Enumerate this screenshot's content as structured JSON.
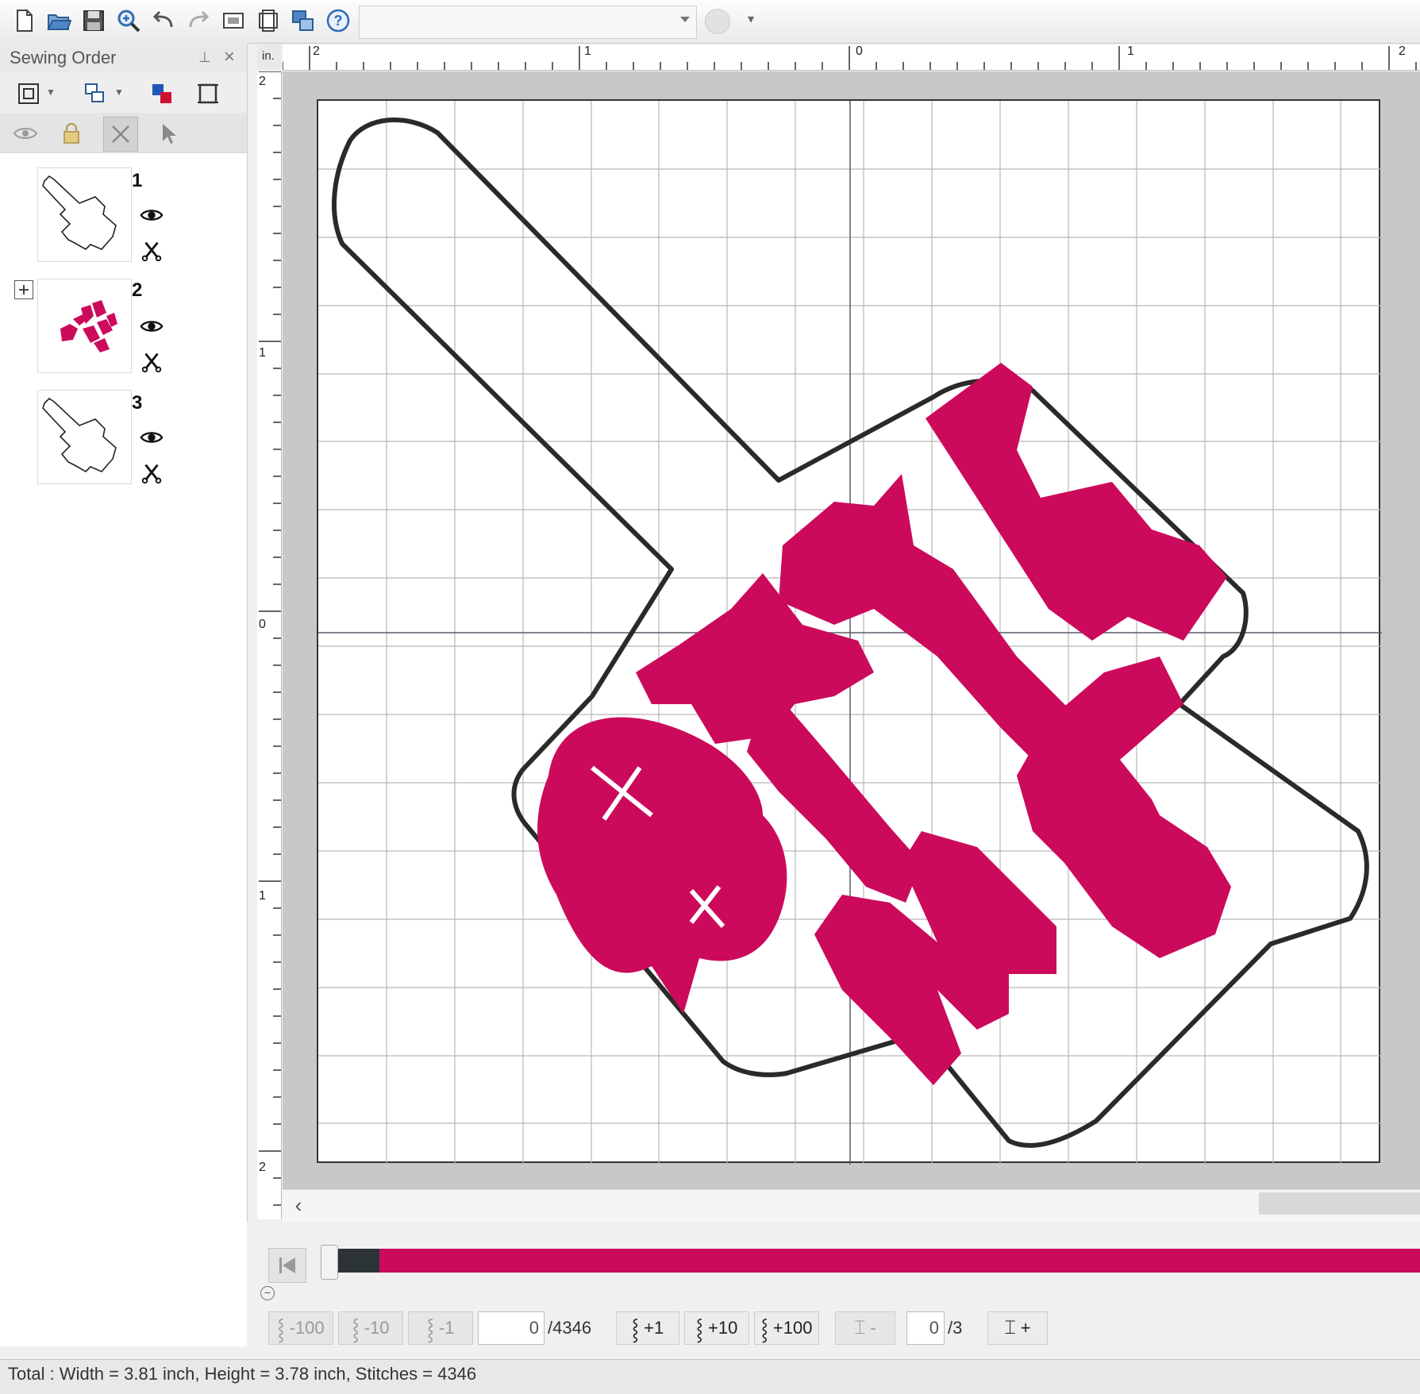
{
  "toolbar": {
    "icons": [
      "new-file-icon",
      "open-folder-icon",
      "save-icon",
      "zoom-in-icon",
      "undo-icon",
      "redo-icon",
      "view-icon",
      "page-icon",
      "transfer-icon",
      "help-icon"
    ],
    "combo_value": ""
  },
  "panel": {
    "title": "Sewing Order",
    "items": [
      {
        "num": "1",
        "type": "outline"
      },
      {
        "num": "2",
        "type": "text-embroidery"
      },
      {
        "num": "3",
        "type": "outline"
      }
    ]
  },
  "ruler": {
    "unit": "in.",
    "top_labels": [
      "2",
      "1",
      "0",
      "1",
      "2"
    ],
    "left_labels": [
      "2",
      "1",
      "0",
      "1",
      "2"
    ]
  },
  "design": {
    "thread_color": "#cc0a5c",
    "outline_color": "#2a2a2a"
  },
  "simulator": {
    "buttons_back": [
      "-100",
      "-10",
      "-1"
    ],
    "current_stitch": "0",
    "total_stitches": "/4346",
    "buttons_fwd": [
      "+1",
      "+10",
      "+100"
    ],
    "color_minus": "-",
    "current_color": "0",
    "total_colors": "/3",
    "color_plus": "+",
    "progress_fraction": 0.0
  },
  "status": {
    "text": "Total : Width = 3.81 inch, Height = 3.78 inch, Stitches = 4346"
  }
}
